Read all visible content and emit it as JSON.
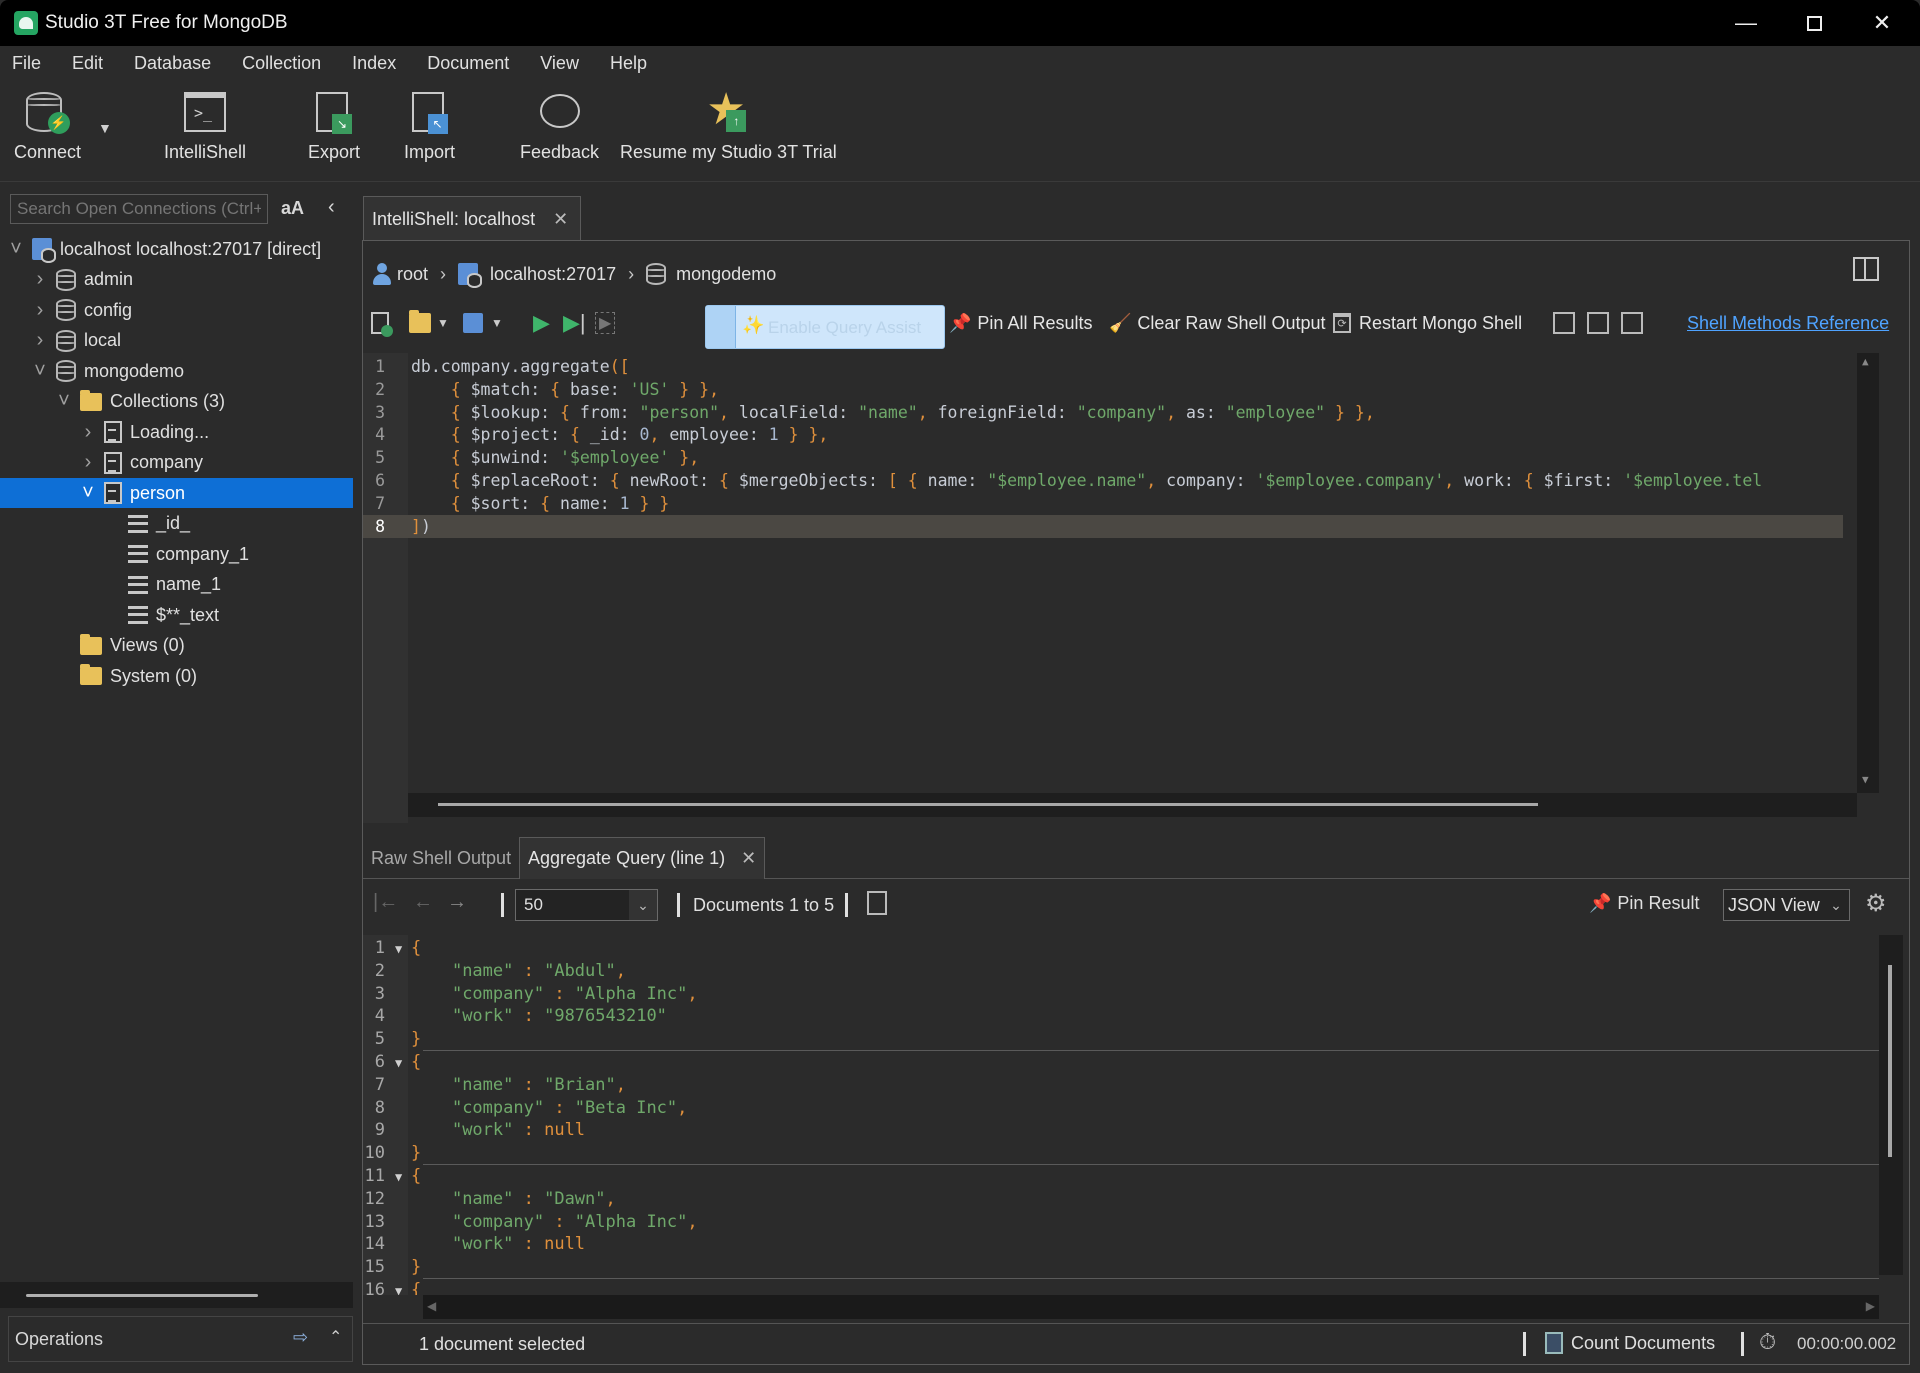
{
  "window": {
    "title": "Studio 3T Free for MongoDB",
    "controls": [
      "minimize",
      "maximize",
      "close"
    ]
  },
  "menu": [
    "File",
    "Edit",
    "Database",
    "Collection",
    "Index",
    "Document",
    "View",
    "Help"
  ],
  "toolbar": {
    "connect": "Connect",
    "intellishell": "IntelliShell",
    "export": "Export",
    "import": "Import",
    "feedback": "Feedback",
    "trial": "Resume my Studio 3T Trial"
  },
  "sidebar": {
    "search_placeholder": "Search Open Connections (Ctrl+",
    "case_toggle": "aA",
    "tree": [
      {
        "label": "localhost localhost:27017 [direct]",
        "icon": "server-icon",
        "level": 0,
        "expanded": true
      },
      {
        "label": "admin",
        "icon": "database-icon",
        "level": 1,
        "expanded": false
      },
      {
        "label": "config",
        "icon": "database-icon",
        "level": 1,
        "expanded": false
      },
      {
        "label": "local",
        "icon": "database-icon",
        "level": 1,
        "expanded": false
      },
      {
        "label": "mongodemo",
        "icon": "database-icon",
        "level": 1,
        "expanded": true
      },
      {
        "label": "Collections (3)",
        "icon": "folder-icon",
        "level": 2,
        "expanded": true
      },
      {
        "label": "Loading...",
        "icon": "collection-icon",
        "level": 3,
        "expanded": false
      },
      {
        "label": "company",
        "icon": "collection-icon",
        "level": 3,
        "expanded": false
      },
      {
        "label": "person",
        "icon": "collection-icon",
        "level": 3,
        "expanded": true,
        "selected": true
      },
      {
        "label": "_id_",
        "icon": "index-icon",
        "level": 4
      },
      {
        "label": "company_1",
        "icon": "index-icon",
        "level": 4
      },
      {
        "label": "name_1",
        "icon": "index-icon",
        "level": 4
      },
      {
        "label": "$**_text",
        "icon": "index-icon",
        "level": 4
      },
      {
        "label": "Views (0)",
        "icon": "folder-icon",
        "level": 2
      },
      {
        "label": "System (0)",
        "icon": "folder-icon",
        "level": 2
      }
    ],
    "operations_label": "Operations"
  },
  "shell": {
    "tab_label": "IntelliShell: localhost",
    "breadcrumb": {
      "user": "root",
      "host": "localhost:27017",
      "database": "mongodemo"
    },
    "toolbar": {
      "query_assist": "Enable Query Assist",
      "pin_all": "Pin All Results",
      "clear_output": "Clear Raw Shell Output",
      "restart": "Restart Mongo Shell",
      "reference_link": "Shell Methods Reference"
    },
    "active_line": 8,
    "code": [
      [
        [
          "k",
          "db.company.aggregate"
        ],
        [
          "p",
          "(["
        ]
      ],
      [
        [
          "c",
          "    "
        ],
        [
          "p",
          "{ "
        ],
        [
          "k",
          "$match"
        ],
        [
          "c",
          ": "
        ],
        [
          "p",
          "{ "
        ],
        [
          "k",
          "base"
        ],
        [
          "c",
          ": "
        ],
        [
          "s",
          "'US'"
        ],
        [
          "p",
          " } },"
        ]
      ],
      [
        [
          "c",
          "    "
        ],
        [
          "p",
          "{ "
        ],
        [
          "k",
          "$lookup"
        ],
        [
          "c",
          ": "
        ],
        [
          "p",
          "{ "
        ],
        [
          "k",
          "from"
        ],
        [
          "c",
          ": "
        ],
        [
          "s",
          "\"person\""
        ],
        [
          "p",
          ", "
        ],
        [
          "k",
          "localField"
        ],
        [
          "c",
          ": "
        ],
        [
          "s",
          "\"name\""
        ],
        [
          "p",
          ", "
        ],
        [
          "k",
          "foreignField"
        ],
        [
          "c",
          ": "
        ],
        [
          "s",
          "\"company\""
        ],
        [
          "p",
          ", "
        ],
        [
          "k",
          "as"
        ],
        [
          "c",
          ": "
        ],
        [
          "s",
          "\"employee\""
        ],
        [
          "p",
          " } },"
        ]
      ],
      [
        [
          "c",
          "    "
        ],
        [
          "p",
          "{ "
        ],
        [
          "k",
          "$project"
        ],
        [
          "c",
          ": "
        ],
        [
          "p",
          "{ "
        ],
        [
          "k",
          "_id"
        ],
        [
          "c",
          ": "
        ],
        [
          "n",
          "0"
        ],
        [
          "p",
          ", "
        ],
        [
          "k",
          "employee"
        ],
        [
          "c",
          ": "
        ],
        [
          "n",
          "1"
        ],
        [
          "p",
          " } },"
        ]
      ],
      [
        [
          "c",
          "    "
        ],
        [
          "p",
          "{ "
        ],
        [
          "k",
          "$unwind"
        ],
        [
          "c",
          ": "
        ],
        [
          "s",
          "'$employee'"
        ],
        [
          "p",
          " },"
        ]
      ],
      [
        [
          "c",
          "    "
        ],
        [
          "p",
          "{ "
        ],
        [
          "k",
          "$replaceRoot"
        ],
        [
          "c",
          ": "
        ],
        [
          "p",
          "{ "
        ],
        [
          "k",
          "newRoot"
        ],
        [
          "c",
          ": "
        ],
        [
          "p",
          "{ "
        ],
        [
          "k",
          "$mergeObjects"
        ],
        [
          "c",
          ": "
        ],
        [
          "p",
          "[ { "
        ],
        [
          "k",
          "name"
        ],
        [
          "c",
          ": "
        ],
        [
          "s",
          "\"$employee.name\""
        ],
        [
          "p",
          ", "
        ],
        [
          "k",
          "company"
        ],
        [
          "c",
          ": "
        ],
        [
          "s",
          "'$employee.company'"
        ],
        [
          "p",
          ", "
        ],
        [
          "k",
          "work"
        ],
        [
          "c",
          ": "
        ],
        [
          "p",
          "{ "
        ],
        [
          "k",
          "$first"
        ],
        [
          "c",
          ": "
        ],
        [
          "s",
          "'$employee.tel"
        ]
      ],
      [
        [
          "c",
          "    "
        ],
        [
          "p",
          "{ "
        ],
        [
          "k",
          "$sort"
        ],
        [
          "c",
          ": "
        ],
        [
          "p",
          "{ "
        ],
        [
          "k",
          "name"
        ],
        [
          "c",
          ": "
        ],
        [
          "n",
          "1"
        ],
        [
          "p",
          " } }"
        ]
      ],
      [
        [
          "p",
          "]"
        ],
        [
          "k",
          ")"
        ]
      ]
    ]
  },
  "results": {
    "tabs": [
      {
        "label": "Raw Shell Output",
        "active": false
      },
      {
        "label": "Aggregate Query (line 1)",
        "active": true,
        "closable": true
      }
    ],
    "page_size": "50",
    "range_label": "Documents 1 to 5",
    "pin_result": "Pin Result",
    "view_mode": "JSON View",
    "documents": [
      {
        "name": "\"Abdul\"",
        "company": "\"Alpha Inc\"",
        "work": "\"9876543210\"",
        "work_is_null": false
      },
      {
        "name": "\"Brian\"",
        "company": "\"Beta Inc\"",
        "work": "null",
        "work_is_null": true
      },
      {
        "name": "\"Dawn\"",
        "company": "\"Alpha Inc\"",
        "work": "null",
        "work_is_null": true
      }
    ],
    "status": "1 document selected",
    "count_documents": "Count Documents",
    "elapsed": "00:00:00.002"
  }
}
